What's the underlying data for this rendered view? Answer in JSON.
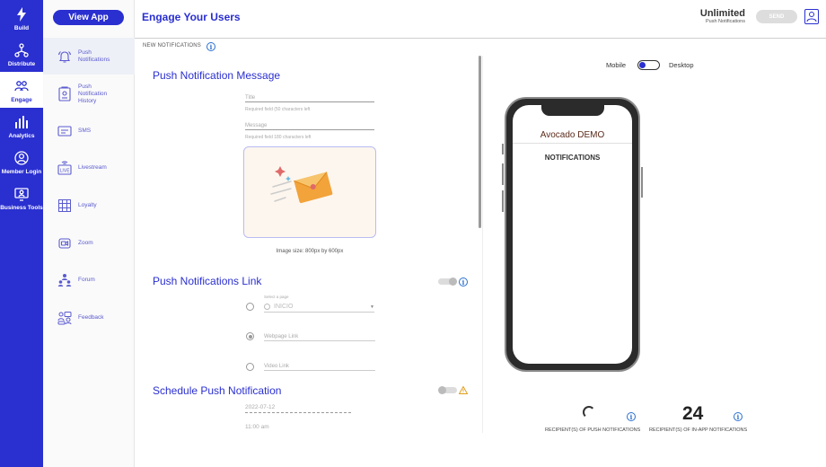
{
  "rail": [
    {
      "label": "Build",
      "icon": "lightning-icon"
    },
    {
      "label": "Distribute",
      "icon": "network-icon"
    },
    {
      "label": "Engage",
      "icon": "people-icon",
      "active": true
    },
    {
      "label": "Analytics",
      "icon": "bar-chart-icon"
    },
    {
      "label": "Member Login",
      "icon": "user-circle-icon"
    },
    {
      "label": "Business Tools",
      "icon": "monitor-user-icon"
    }
  ],
  "subnav": {
    "view_app": "View App",
    "items": [
      {
        "label": "Push Notifications",
        "icon": "bell-icon",
        "active": true
      },
      {
        "label": "Push Notification History",
        "icon": "history-icon"
      },
      {
        "label": "SMS",
        "icon": "sms-icon"
      },
      {
        "label": "Livestream",
        "icon": "live-icon"
      },
      {
        "label": "Loyalty",
        "icon": "loyalty-icon"
      },
      {
        "label": "Zoom",
        "icon": "zoom-icon"
      },
      {
        "label": "Forum",
        "icon": "forum-icon"
      },
      {
        "label": "Feedback",
        "icon": "feedback-icon"
      }
    ]
  },
  "header": {
    "title": "Engage Your Users",
    "plan": "Unlimited",
    "plan_sub": "Push Notifications",
    "send": "SEND"
  },
  "form": {
    "new_notifications": "NEW NOTIFICATIONS",
    "message_section": "Push Notification Message",
    "title_placeholder": "Title",
    "title_helper": "Required field (50 characters left",
    "message_placeholder": "Message",
    "message_helper": "Required field 180 characters left",
    "image_caption": "Image size: 800px by 600px",
    "link_section": "Push Notifications Link",
    "select_page_label": "Select a page",
    "select_page_value": "INICIO",
    "webpage_link": "Webpage Link",
    "video_link": "Video Link",
    "schedule_section": "Schedule Push Notification",
    "date": "2022-07-12",
    "time": "11:00 am"
  },
  "preview": {
    "mobile": "Mobile",
    "desktop": "Desktop",
    "app_name": "Avocado DEMO",
    "screen_title": "NOTIFICATIONS"
  },
  "stats": {
    "push_label": "RECIPIENT(S) OF PUSH NOTIFICATIONS",
    "inapp_value": "24",
    "inapp_label": "RECIPIENT(S) OF IN-APP NOTIFICATIONS"
  },
  "colors": {
    "accent": "#2a2fd0",
    "link": "#2a6fd0"
  }
}
